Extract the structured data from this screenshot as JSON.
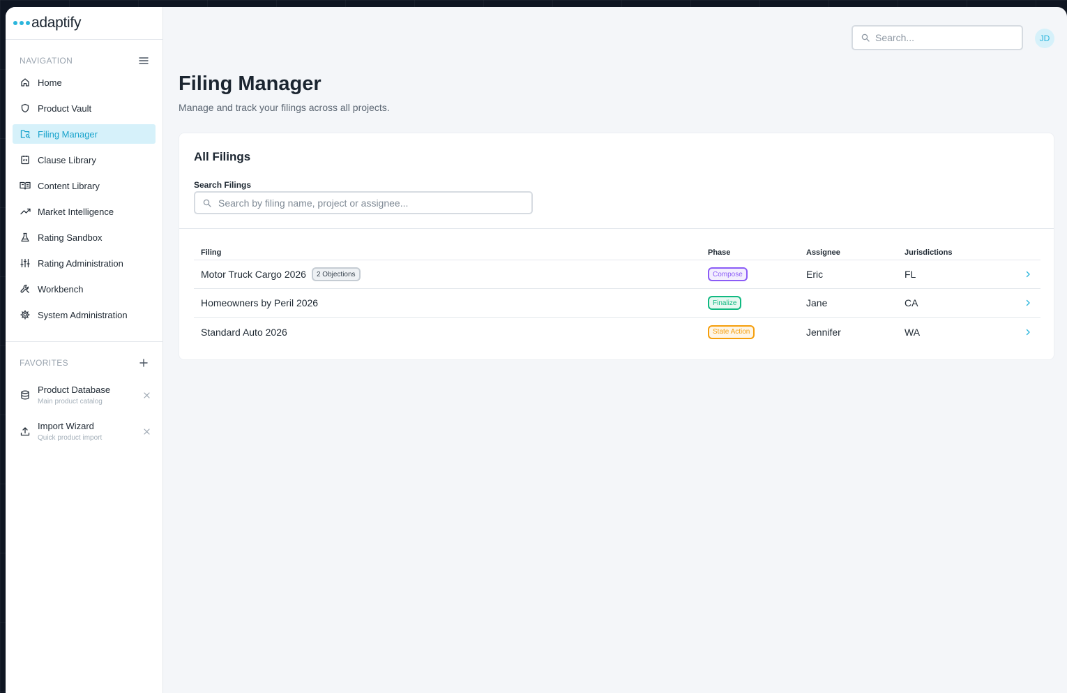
{
  "brand": {
    "name": "adaptify"
  },
  "sidebar": {
    "nav_title": "NAVIGATION",
    "items": [
      {
        "label": "Home",
        "icon": "home-icon",
        "active": false
      },
      {
        "label": "Product Vault",
        "icon": "shield-icon",
        "active": false
      },
      {
        "label": "Filing Manager",
        "icon": "folder-search-icon",
        "active": true
      },
      {
        "label": "Clause Library",
        "icon": "code-file-icon",
        "active": false
      },
      {
        "label": "Content Library",
        "icon": "book-open-icon",
        "active": false
      },
      {
        "label": "Market Intelligence",
        "icon": "trending-up-icon",
        "active": false
      },
      {
        "label": "Rating Sandbox",
        "icon": "flask-icon",
        "active": false
      },
      {
        "label": "Rating Administration",
        "icon": "sliders-icon",
        "active": false
      },
      {
        "label": "Workbench",
        "icon": "wrench-icon",
        "active": false
      },
      {
        "label": "System Administration",
        "icon": "gear-icon",
        "active": false
      }
    ],
    "favorites_title": "FAVORITES",
    "favorites": [
      {
        "title": "Product Database",
        "subtitle": "Main product catalog",
        "icon": "database-icon"
      },
      {
        "title": "Import Wizard",
        "subtitle": "Quick product import",
        "icon": "upload-icon"
      }
    ]
  },
  "header": {
    "search_placeholder": "Search...",
    "avatar_initials": "JD"
  },
  "page": {
    "title": "Filing Manager",
    "subtitle": "Manage and track your filings across all projects."
  },
  "filings": {
    "title": "All Filings",
    "filter_label": "Search Filings",
    "filter_placeholder": "Search by filing name, project or assignee...",
    "columns": {
      "filing": "Filing",
      "phase": "Phase",
      "assignee": "Assignee",
      "jurisdictions": "Jurisdictions"
    },
    "rows": [
      {
        "filing": "Motor Truck Cargo 2026",
        "badge": "2 Objections",
        "phase": "Compose",
        "phase_color": "#8b5cf6",
        "phase_bg": "#f3eefe",
        "assignee": "Eric",
        "jurisdictions": "FL"
      },
      {
        "filing": "Homeowners by Peril 2026",
        "badge": "",
        "phase": "Finalize",
        "phase_color": "#10b981",
        "phase_bg": "#e8f8f1",
        "assignee": "Jane",
        "jurisdictions": "CA"
      },
      {
        "filing": "Standard Auto 2026",
        "badge": "",
        "phase": "State Action",
        "phase_color": "#f59e0b",
        "phase_bg": "#fef5e6",
        "assignee": "Jennifer",
        "jurisdictions": "WA"
      }
    ]
  },
  "colors": {
    "accent": "#2bb5dc",
    "active_bg": "#d6f1fa"
  }
}
